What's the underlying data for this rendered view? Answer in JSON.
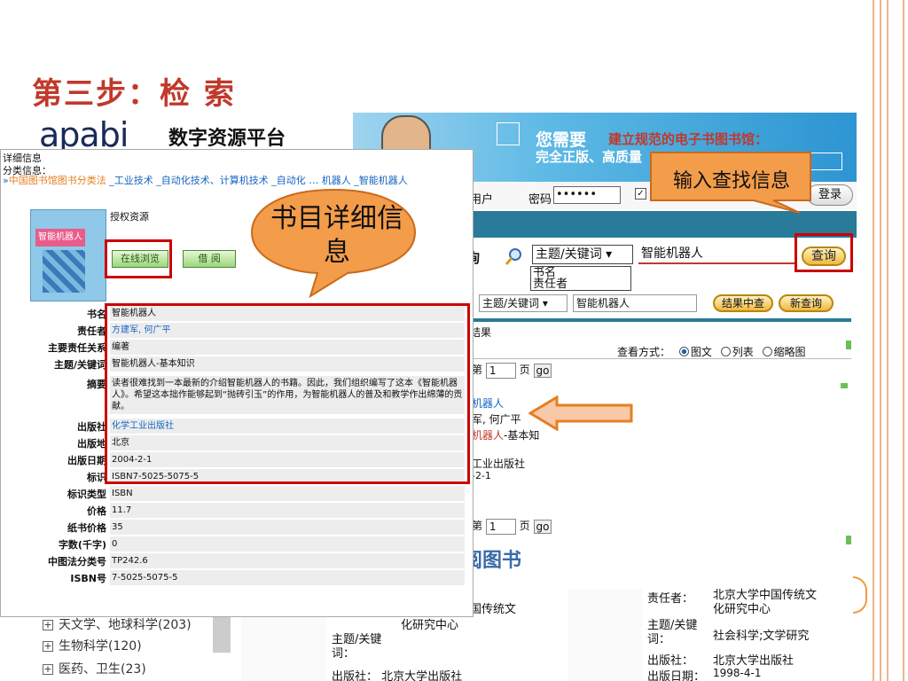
{
  "slide": {
    "title": "第三步：检 索"
  },
  "brand": {
    "logo": "apabi",
    "platform": "数字资源平台"
  },
  "banner": {
    "line1": "您需要",
    "line1b": "建立规范的电子书图书馆：",
    "line2": "完全正版、高质量"
  },
  "login": {
    "user_label": "用户",
    "pwd_label": "密码",
    "pwd_value": "••••••",
    "login_button": "登录"
  },
  "search": {
    "label": "询",
    "field_select": "主题/关键词 ▾",
    "query": "智能机器人",
    "button": "查询",
    "dropdown_options": [
      "书名",
      "责任者"
    ]
  },
  "refine": {
    "field_select": "主题/关键词 ▾",
    "query": "智能机器人",
    "in_results_button": "结果中查",
    "new_query_button": "新查询",
    "results_label": "结果",
    "view_mode_label": "查看方式：",
    "view_options": [
      "图文",
      "列表",
      "缩略图"
    ]
  },
  "pager": {
    "prefix": "第",
    "page": "1",
    "suffix": "页",
    "go": "go"
  },
  "result": {
    "title": "机器人",
    "author": "军, 何广平",
    "kw_red": "机器人",
    "kw_rest": "-基本知",
    "publisher": "工业出版社",
    "date": "-2-1"
  },
  "borrow_heading": "阅图书",
  "tree": [
    {
      "label": "天文学、地球科学(203)"
    },
    {
      "label": "生物科学(120)"
    },
    {
      "label": "医药、卫生(23)"
    }
  ],
  "bottom_book1": {
    "org_frag": "国传统文",
    "org": "化研究中心",
    "kw_label": "主题/关键\n词：",
    "pub_label": "出版社：  北京大学出版社"
  },
  "bottom_book2": {
    "author_label": "责任者：",
    "author": "北京大学中国传统文\n化研究中心",
    "kw_label": "主题/关键\n词：",
    "kw": "社会科学;文学研究",
    "pub_label": "出版社：",
    "pub": "北京大学出版社",
    "date_label": "出版日期：",
    "date": "1998-4-1"
  },
  "detail": {
    "title": "详细信息",
    "category_label": "分类信息：",
    "category_prefix": "»",
    "category_root": "中国图书馆图书分类法",
    "category_path": " _工业技术 _自动化技术、计算机技术 _自动化 … 机器人 _智能机器人",
    "authorized": "授权资源",
    "cover_text": "智能机器人",
    "online_button": "在线浏览",
    "borrow_button": "借 阅",
    "fields": [
      {
        "label": "书名",
        "value": "智能机器人",
        "link": false
      },
      {
        "label": "责任者",
        "value": "方建军, 何广平",
        "link": true
      },
      {
        "label": "主要责任关系",
        "value": "编著",
        "link": false
      },
      {
        "label": "主题/关键词",
        "value": "智能机器人-基本知识",
        "link": false
      },
      {
        "label": "摘要",
        "value": "读者很难找到一本最新的介绍智能机器人的书籍。因此，我们组织编写了这本《智能机器人》。希望这本拙作能够起到“抛砖引玉”的作用，为智能机器人的普及和教学作出绵薄的贡献。",
        "link": false
      },
      {
        "label": "出版社",
        "value": "化学工业出版社",
        "link": true
      },
      {
        "label": "出版地",
        "value": "北京",
        "link": false
      },
      {
        "label": "出版日期",
        "value": "2004-2-1",
        "link": false
      },
      {
        "label": "标识",
        "value": "ISBN7-5025-5075-5",
        "link": false
      },
      {
        "label": "标识类型",
        "value": "ISBN",
        "link": false
      },
      {
        "label": "价格",
        "value": "11.7",
        "link": false
      },
      {
        "label": "纸书价格",
        "value": "35",
        "link": false
      },
      {
        "label": "字数(千字)",
        "value": "0",
        "link": false
      },
      {
        "label": "中图法分类号",
        "value": "TP242.6",
        "link": false
      },
      {
        "label": "ISBN号",
        "value": "7-5025-5075-5",
        "link": false
      }
    ]
  },
  "callouts": {
    "book_detail": "书目详细信息",
    "input_search": "输入查找信息"
  },
  "colors": {
    "title_red": "#c0392b",
    "highlight_red": "#cc0000",
    "callout_orange": "#f39c4a",
    "link_blue": "#1565c0"
  }
}
